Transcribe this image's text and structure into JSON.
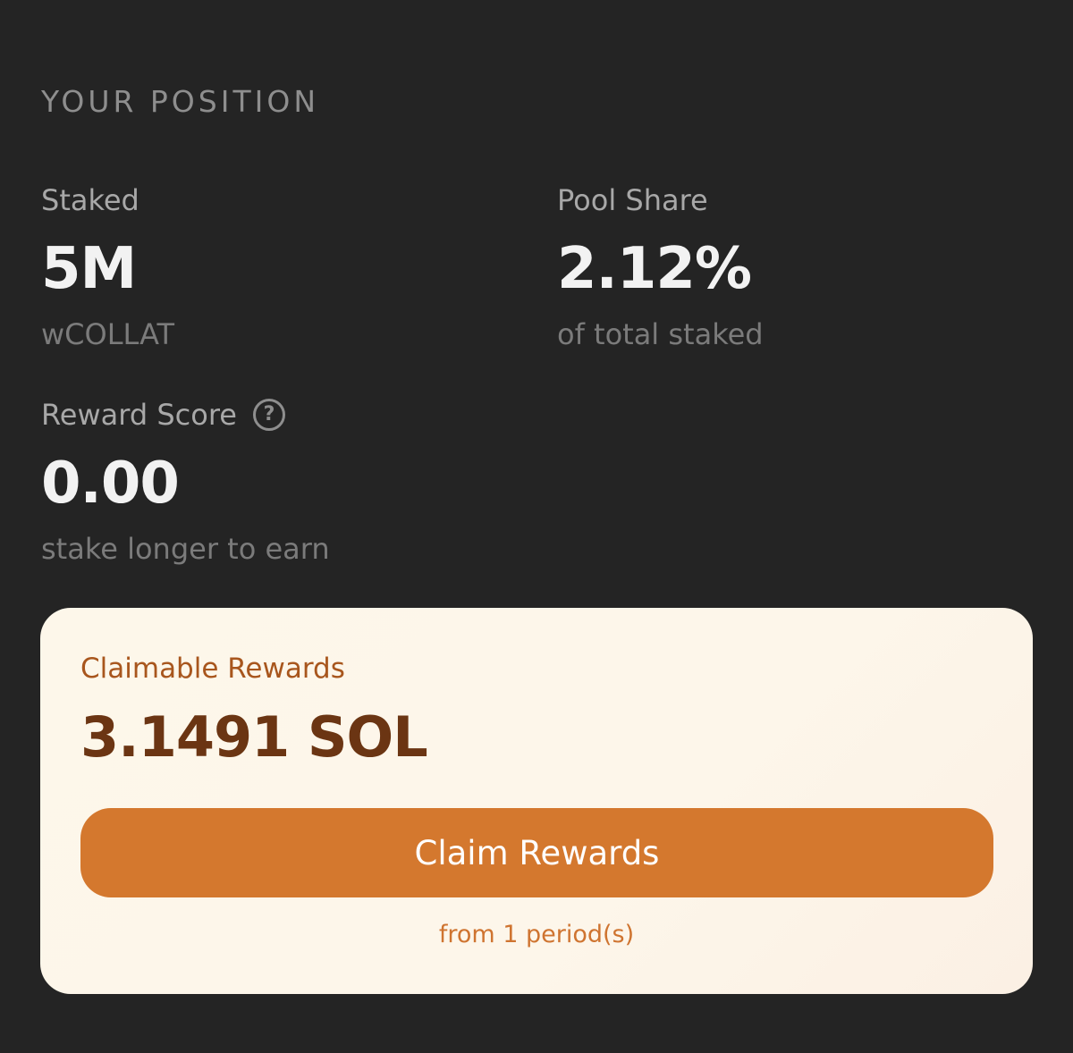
{
  "position": {
    "section_title": "YOUR POSITION",
    "staked": {
      "label": "Staked",
      "value": "5M",
      "sub": "wCOLLAT"
    },
    "pool_share": {
      "label": "Pool Share",
      "value": "2.12%",
      "sub": "of total staked"
    },
    "reward_score": {
      "label": "Reward Score",
      "help_icon_glyph": "?",
      "value": "0.00",
      "sub": "stake longer to earn"
    }
  },
  "rewards": {
    "label": "Claimable Rewards",
    "amount": "3.1491 SOL",
    "claim_button_label": "Claim Rewards",
    "footnote": "from 1 period(s)"
  },
  "colors": {
    "background": "#242424",
    "card_background": "#fdf7ea",
    "accent": "#d4782e",
    "rewards_text": "#a8561d",
    "amount_text": "#6b3513"
  },
  "icons": {
    "help": "question-circle-icon"
  }
}
